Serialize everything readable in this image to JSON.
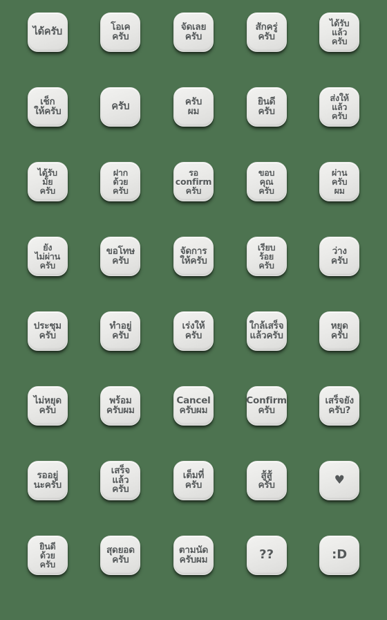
{
  "sheet": {
    "background_color": "#4d7350",
    "tile_color": "#ebebe9",
    "text_color": "#55595a",
    "columns": 5,
    "rows": 8,
    "total_stickers": 40
  },
  "stickers": [
    {
      "id": "s01",
      "text": "ได้ครับ",
      "lines": 1,
      "kind": "thai"
    },
    {
      "id": "s02",
      "text": "โอเค\nครับ",
      "lines": 2,
      "kind": "thai"
    },
    {
      "id": "s03",
      "text": "จัดเลย\nครับ",
      "lines": 2,
      "kind": "thai"
    },
    {
      "id": "s04",
      "text": "สักครู่\nครับ",
      "lines": 2,
      "kind": "thai"
    },
    {
      "id": "s05",
      "text": "ได้รับ\nแล้ว\nครับ",
      "lines": 3,
      "kind": "thai"
    },
    {
      "id": "s06",
      "text": "เช็ก\nให้ครับ",
      "lines": 2,
      "kind": "thai"
    },
    {
      "id": "s07",
      "text": "ครับ",
      "lines": 1,
      "kind": "thai"
    },
    {
      "id": "s08",
      "text": "ครับ\nผม",
      "lines": 2,
      "kind": "thai"
    },
    {
      "id": "s09",
      "text": "ยินดี\nครับ",
      "lines": 2,
      "kind": "thai"
    },
    {
      "id": "s10",
      "text": "ส่งให้\nแล้ว\nครับ",
      "lines": 3,
      "kind": "thai"
    },
    {
      "id": "s11",
      "text": "ได้รับ\nมั้ย\nครับ",
      "lines": 3,
      "kind": "thai"
    },
    {
      "id": "s12",
      "text": "ฝาก\nด้วย\nครับ",
      "lines": 3,
      "kind": "thai"
    },
    {
      "id": "s13",
      "text": "รอ\nconfirm\nครับ",
      "lines": 3,
      "kind": "mixed"
    },
    {
      "id": "s14",
      "text": "ขอบ\nคุณ\nครับ",
      "lines": 3,
      "kind": "thai"
    },
    {
      "id": "s15",
      "text": "ผ่าน\nครับ\nผม",
      "lines": 3,
      "kind": "thai"
    },
    {
      "id": "s16",
      "text": "ยัง\nไม่ผ่าน\nครับ",
      "lines": 3,
      "kind": "thai"
    },
    {
      "id": "s17",
      "text": "ขอโทษ\nครับ",
      "lines": 2,
      "kind": "thai"
    },
    {
      "id": "s18",
      "text": "จัดการ\nให้ครับ",
      "lines": 2,
      "kind": "thai"
    },
    {
      "id": "s19",
      "text": "เรียบ\nร้อย\nครับ",
      "lines": 3,
      "kind": "thai"
    },
    {
      "id": "s20",
      "text": "ว่าง\nครับ",
      "lines": 2,
      "kind": "thai"
    },
    {
      "id": "s21",
      "text": "ประชุม\nครับ",
      "lines": 2,
      "kind": "thai"
    },
    {
      "id": "s22",
      "text": "ทำอยู่\nครับ",
      "lines": 2,
      "kind": "thai"
    },
    {
      "id": "s23",
      "text": "เร่งให้\nครับ",
      "lines": 2,
      "kind": "thai"
    },
    {
      "id": "s24",
      "text": "ใกล้เสร็จ\nแล้วครับ",
      "lines": 2,
      "kind": "thai"
    },
    {
      "id": "s25",
      "text": "หยุด\nครับ",
      "lines": 2,
      "kind": "thai"
    },
    {
      "id": "s26",
      "text": "ไม่หยุด\nครับ",
      "lines": 2,
      "kind": "thai"
    },
    {
      "id": "s27",
      "text": "พร้อม\nครับผม",
      "lines": 2,
      "kind": "thai"
    },
    {
      "id": "s28",
      "text": "Cancel\nครับผม",
      "lines": 2,
      "kind": "mixed"
    },
    {
      "id": "s29",
      "text": "Confirm\nครับ",
      "lines": 2,
      "kind": "mixed"
    },
    {
      "id": "s30",
      "text": "เสร็จยัง\nครับ?",
      "lines": 2,
      "kind": "thai"
    },
    {
      "id": "s31",
      "text": "รออยู่\nนะครับ",
      "lines": 2,
      "kind": "thai"
    },
    {
      "id": "s32",
      "text": "เสร็จแล้ว\nครับ",
      "lines": 2,
      "kind": "thai"
    },
    {
      "id": "s33",
      "text": "เต็มที่\nครับ",
      "lines": 2,
      "kind": "thai"
    },
    {
      "id": "s34",
      "text": "สู้สู้\nครับ",
      "lines": 2,
      "kind": "thai"
    },
    {
      "id": "s35",
      "text": "♥",
      "lines": 1,
      "kind": "glyph-heart"
    },
    {
      "id": "s36",
      "text": "ยินดี\nด้วย\nครับ",
      "lines": 3,
      "kind": "thai"
    },
    {
      "id": "s37",
      "text": "สุดยอด\nครับ",
      "lines": 2,
      "kind": "thai"
    },
    {
      "id": "s38",
      "text": "ตามนัด\nครับผม",
      "lines": 2,
      "kind": "thai"
    },
    {
      "id": "s39",
      "text": "??",
      "lines": 1,
      "kind": "glyph-big"
    },
    {
      "id": "s40",
      "text": ":D",
      "lines": 1,
      "kind": "glyph-big"
    }
  ]
}
